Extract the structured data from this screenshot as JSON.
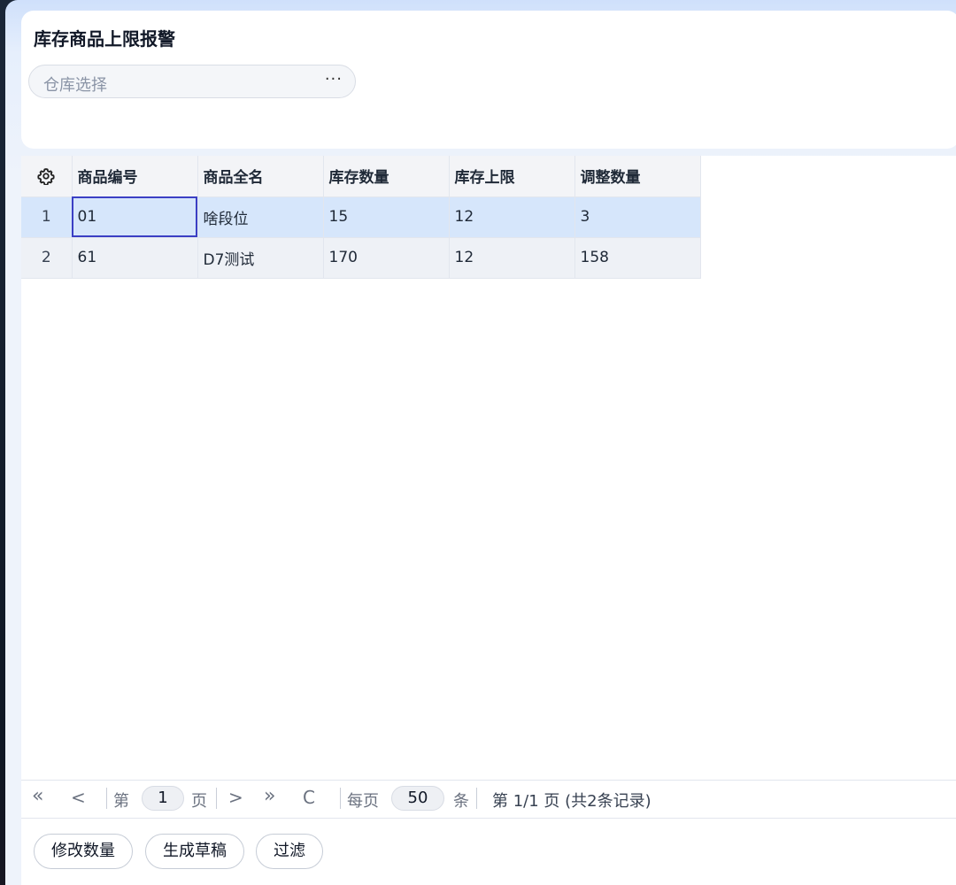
{
  "page": {
    "title": "库存商品上限报警"
  },
  "filter": {
    "warehouse_placeholder": "仓库选择",
    "more_label": "···"
  },
  "table": {
    "columns": [
      "商品编号",
      "商品全名",
      "库存数量",
      "库存上限",
      "调整数量"
    ],
    "rows": [
      {
        "num": "1",
        "code": "01",
        "name": "啥段位",
        "stock": "15",
        "limit": "12",
        "adjust": "3"
      },
      {
        "num": "2",
        "code": "61",
        "name": "D7测试",
        "stock": "170",
        "limit": "12",
        "adjust": "158"
      }
    ]
  },
  "pager": {
    "first": "«",
    "prev": "<",
    "page_prefix": "第",
    "page_value": "1",
    "page_suffix": "页",
    "next": ">",
    "last": "»",
    "refresh": "C",
    "per_page_prefix": "每页",
    "per_page_value": "50",
    "per_page_suffix": "条",
    "summary": "第 1/1 页 (共2条记录)"
  },
  "actions": {
    "modify_qty": "修改数量",
    "generate_draft": "生成草稿",
    "filter": "过滤"
  },
  "icons": {
    "settings": "gear-icon"
  },
  "colors": {
    "selected_row": "#d6e6fb",
    "focus_outline": "#3b3fc4"
  }
}
